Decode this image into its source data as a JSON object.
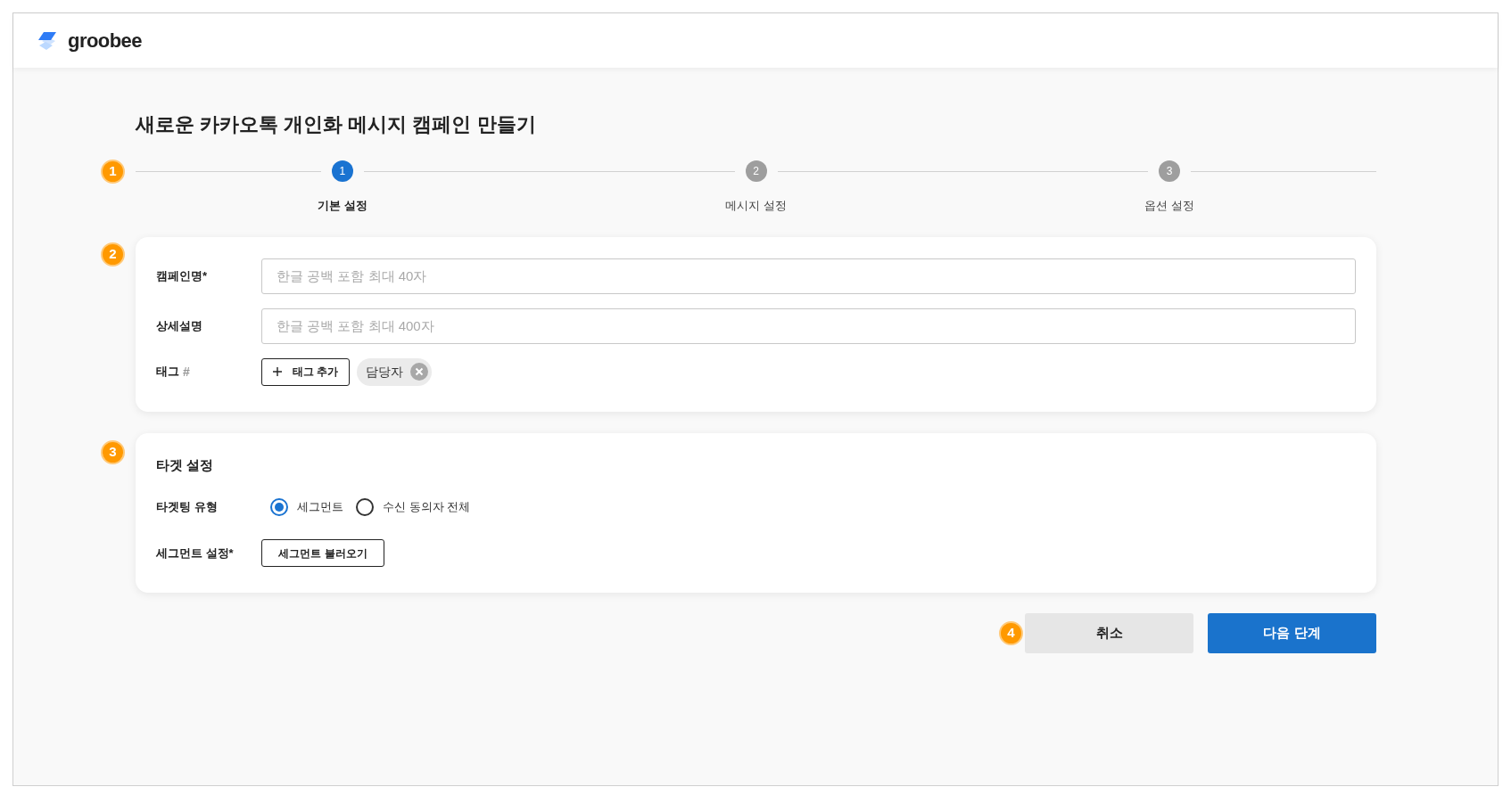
{
  "header": {
    "logo_text": "groobee"
  },
  "title": "새로운 카카오톡 개인화 메시지 캠페인 만들기",
  "stepper": {
    "marker": "1",
    "steps": [
      {
        "number": "1",
        "label": "기본 설정",
        "selected": true
      },
      {
        "number": "2",
        "label": "메시지 설정",
        "selected": false
      },
      {
        "number": "3",
        "label": "옵션 설정",
        "selected": false
      }
    ]
  },
  "basic_card": {
    "marker": "2",
    "fields": [
      {
        "kind": "text",
        "label": "캠페인명*",
        "placeholder": "한글 공백 포함 최대 40자"
      },
      {
        "kind": "text",
        "label": "상세설명",
        "placeholder": "한글 공백 포함 최대 400자"
      },
      {
        "kind": "tags",
        "label": "태그",
        "label_suffix": "#",
        "add_button": "태그 추가",
        "tags": [
          {
            "label": "담당자"
          }
        ]
      }
    ]
  },
  "target_card": {
    "marker": "3",
    "title": "타겟 설정",
    "targeting": {
      "label": "타겟팅 유형",
      "options": [
        {
          "label": "세그먼트",
          "selected": true
        },
        {
          "label": "수신 동의자 전체",
          "selected": false
        }
      ]
    },
    "segment": {
      "label": "세그먼트 설정*",
      "button": "세그먼트 불러오기"
    }
  },
  "actions": {
    "marker": "4",
    "buttons": [
      {
        "kind": "secondary",
        "label": "취소"
      },
      {
        "kind": "primary",
        "label": "다음 단계"
      }
    ]
  }
}
